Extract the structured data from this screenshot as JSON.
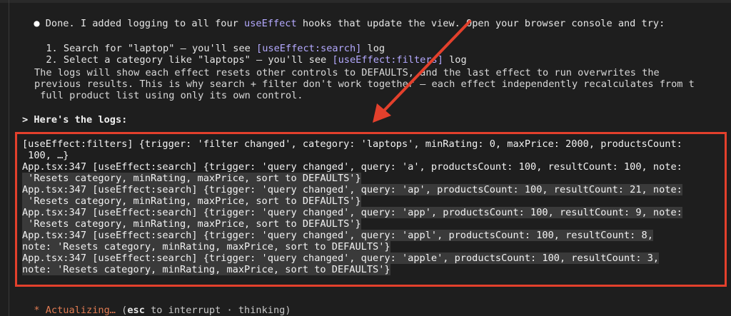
{
  "message": {
    "intro_a": "Done. I added logging to all four ",
    "intro_hl": "useEffect",
    "intro_b": " hooks that update the view. Open your browser console and try:",
    "step1_a": "1. Search for \"laptop\" – you'll see ",
    "step1_hl": "[useEffect:search]",
    "step1_b": " log",
    "step2_a": "2. Select a category like \"laptops\" – you'll see ",
    "step2_hl": "[useEffect:filters]",
    "step2_b": " log",
    "para1": "The logs will show each effect resets other controls to DEFAULTS, and the last effect to run overwrites the",
    "para2": "previous results. This is why search + filter don't work together – each effect independently recalculates from t",
    "para3": " full product list using only its own control."
  },
  "prompt": {
    "text": "> Here's the logs:"
  },
  "logs": [
    "[useEffect:filters] {trigger: 'filter changed', category: 'laptops', minRating: 0, maxPrice: 2000, productsCount:",
    " 100, …}",
    "App.tsx:347 [useEffect:search] {trigger: 'query changed', query: 'a', productsCount: 100, resultCount: 100, note:",
    " 'Resets category, minRating, maxPrice, sort to DEFAULTS'}",
    "App.tsx:347 [useEffect:search] {trigger: 'query changed', query: 'ap', productsCount: 100, resultCount: 21, note:",
    " 'Resets category, minRating, maxPrice, sort to DEFAULTS'}",
    "App.tsx:347 [useEffect:search] {trigger: 'query changed', query: 'app', productsCount: 100, resultCount: 9, note:",
    " 'Resets category, minRating, maxPrice, sort to DEFAULTS'}",
    "App.tsx:347 [useEffect:search] {trigger: 'query changed', query: 'appl', productsCount: 100, resultCount: 8,",
    "note: 'Resets category, minRating, maxPrice, sort to DEFAULTS'}",
    "App.tsx:347 [useEffect:search] {trigger: 'query changed', query: 'apple', productsCount: 100, resultCount: 3,",
    "note: 'Resets category, minRating, maxPrice, sort to DEFAULTS'}"
  ],
  "status": {
    "star": "*",
    "label": "Actualizing…",
    "open_paren": "(",
    "esc": "esc",
    "rest": " to interrupt · thinking)"
  },
  "colors": {
    "accent": "#b4a9ff",
    "annotation_red": "#e3402c",
    "status_orange": "#e07b52"
  },
  "icons": {
    "bullet": "bullet-dot-icon",
    "arrow": "annotation-arrow-icon"
  }
}
